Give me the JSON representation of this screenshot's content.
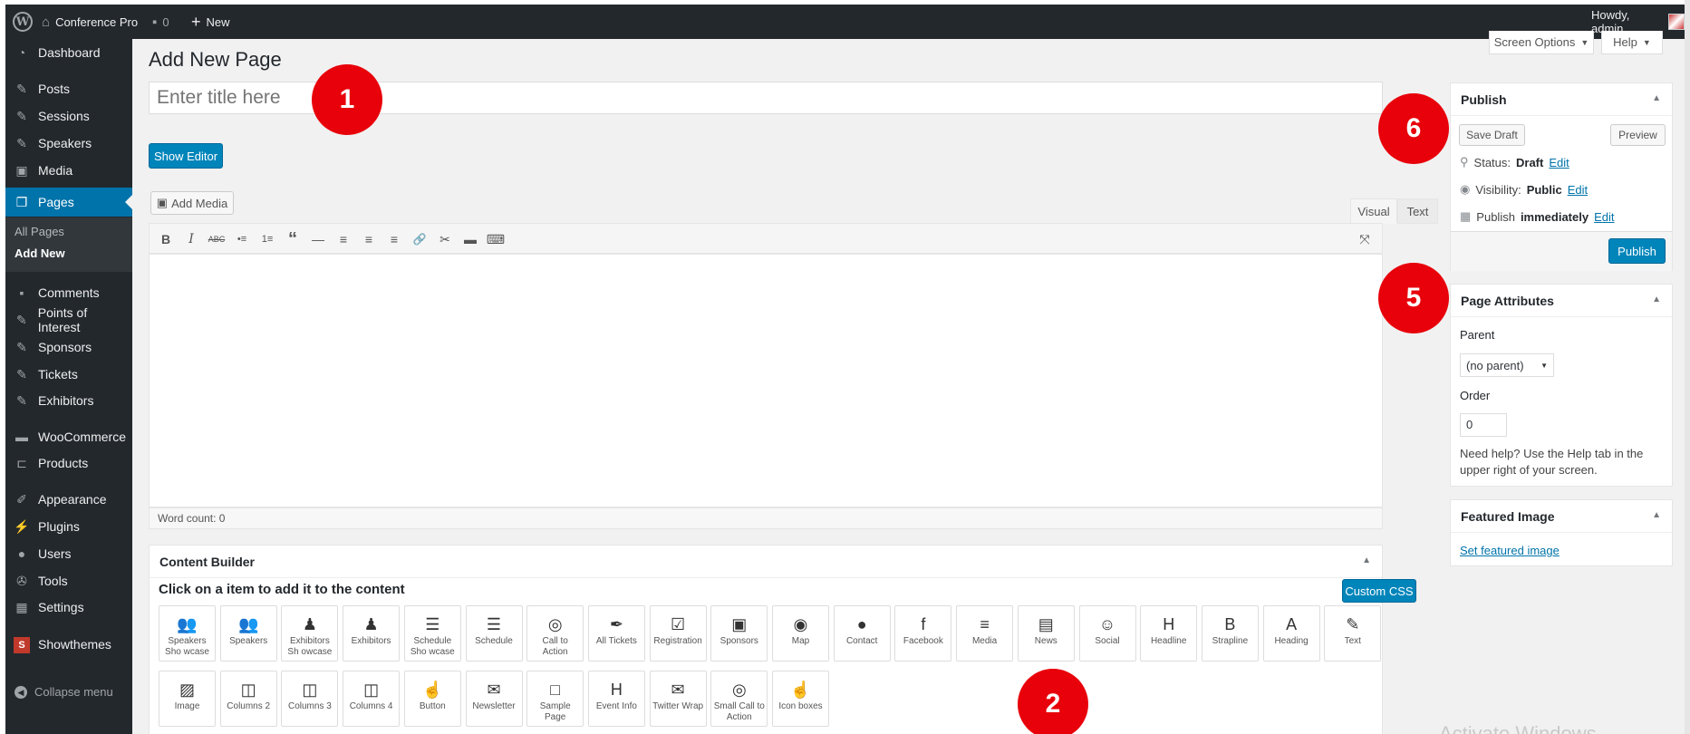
{
  "admin_bar": {
    "site_name": "Conference Pro",
    "comments_count": "0",
    "new_label": "New",
    "greeting": "Howdy, admin"
  },
  "sidebar": {
    "items": [
      {
        "label": "Dashboard",
        "icon": "dashboard-icon"
      },
      {
        "label": "Posts",
        "icon": "pin-icon"
      },
      {
        "label": "Sessions",
        "icon": "pin-icon"
      },
      {
        "label": "Speakers",
        "icon": "pin-icon"
      },
      {
        "label": "Media",
        "icon": "media-icon"
      },
      {
        "label": "Pages",
        "icon": "pages-icon"
      },
      {
        "label": "Comments",
        "icon": "comment-icon"
      },
      {
        "label": "Points of Interest",
        "icon": "pin-icon"
      },
      {
        "label": "Sponsors",
        "icon": "pin-icon"
      },
      {
        "label": "Tickets",
        "icon": "pin-icon"
      },
      {
        "label": "Exhibitors",
        "icon": "pin-icon"
      },
      {
        "label": "WooCommerce",
        "icon": "woocommerce-icon"
      },
      {
        "label": "Products",
        "icon": "cart-icon"
      },
      {
        "label": "Appearance",
        "icon": "brush-icon"
      },
      {
        "label": "Plugins",
        "icon": "plugin-icon"
      },
      {
        "label": "Users",
        "icon": "user-icon"
      },
      {
        "label": "Tools",
        "icon": "wrench-icon"
      },
      {
        "label": "Settings",
        "icon": "settings-icon"
      },
      {
        "label": "Showthemes",
        "icon": "showthemes-icon"
      }
    ],
    "submenu": [
      "All Pages",
      "Add New"
    ],
    "collapse_label": "Collapse menu"
  },
  "header": {
    "page_title": "Add New Page",
    "screen_options": "Screen Options",
    "help": "Help"
  },
  "title_field": {
    "placeholder": "Enter title here"
  },
  "editor": {
    "show_editor": "Show Editor",
    "add_media": "Add Media",
    "tab_visual": "Visual",
    "tab_text": "Text",
    "word_count": "Word count: 0",
    "toolbar": [
      "B",
      "I",
      "ABC",
      "•≡",
      "1≡",
      "“",
      "—",
      "≡",
      "≡",
      "≡",
      "🔗",
      "✂",
      "▬",
      "⌨"
    ]
  },
  "content_builder": {
    "title": "Content Builder",
    "instruction": "Click on a item to add it to the content",
    "custom_css": "Custom CSS",
    "row1": [
      {
        "label": "Speakers Sho wcase",
        "glyph": "👥"
      },
      {
        "label": "Speakers",
        "glyph": "👥"
      },
      {
        "label": "Exhibitors Sh owcase",
        "glyph": "♟"
      },
      {
        "label": "Exhibitors",
        "glyph": "♟"
      },
      {
        "label": "Schedule Sho wcase",
        "glyph": "☰"
      },
      {
        "label": "Schedule",
        "glyph": "☰"
      },
      {
        "label": "Call to Action",
        "glyph": "◎"
      },
      {
        "label": "All Tickets",
        "glyph": "✒"
      },
      {
        "label": "Registration",
        "glyph": "☑"
      },
      {
        "label": "Sponsors",
        "glyph": "▣"
      },
      {
        "label": "Map",
        "glyph": "◉"
      },
      {
        "label": "Contact",
        "glyph": "●"
      },
      {
        "label": "Facebook",
        "glyph": "f"
      },
      {
        "label": "Media",
        "glyph": "≡"
      },
      {
        "label": "News",
        "glyph": "▤"
      },
      {
        "label": "Social",
        "glyph": "☺"
      },
      {
        "label": "Headline",
        "glyph": "H"
      },
      {
        "label": "Strapline",
        "glyph": "B"
      },
      {
        "label": "Heading",
        "glyph": "A"
      },
      {
        "label": "Text",
        "glyph": "✎"
      }
    ],
    "row2": [
      {
        "label": "Image",
        "glyph": "▨"
      },
      {
        "label": "Columns 2",
        "glyph": "◫"
      },
      {
        "label": "Columns 3",
        "glyph": "◫"
      },
      {
        "label": "Columns 4",
        "glyph": "◫"
      },
      {
        "label": "Button",
        "glyph": "☝"
      },
      {
        "label": "Newsletter",
        "glyph": "✉"
      },
      {
        "label": "Sample Page",
        "glyph": "□"
      },
      {
        "label": "Event Info",
        "glyph": "H"
      },
      {
        "label": "Twitter Wrap",
        "glyph": "✉"
      },
      {
        "label": "Small Call to Action",
        "glyph": "◎"
      },
      {
        "label": "Icon boxes",
        "glyph": "☝"
      }
    ]
  },
  "publish_box": {
    "title": "Publish",
    "save_draft": "Save Draft",
    "preview": "Preview",
    "status_label": "Status:",
    "status_value": "Draft",
    "visibility_label": "Visibility:",
    "visibility_value": "Public",
    "publish_label": "Publish",
    "publish_value": "immediately",
    "edit": "Edit",
    "publish_button": "Publish"
  },
  "page_attributes": {
    "title": "Page Attributes",
    "parent_label": "Parent",
    "parent_value": "(no parent)",
    "order_label": "Order",
    "order_value": "0",
    "help_text": "Need help? Use the Help tab in the upper right of your screen."
  },
  "featured_image": {
    "title": "Featured Image",
    "link": "Set featured image"
  },
  "badges": [
    "1",
    "2",
    "5",
    "6"
  ],
  "watermark": "Activate Windows"
}
